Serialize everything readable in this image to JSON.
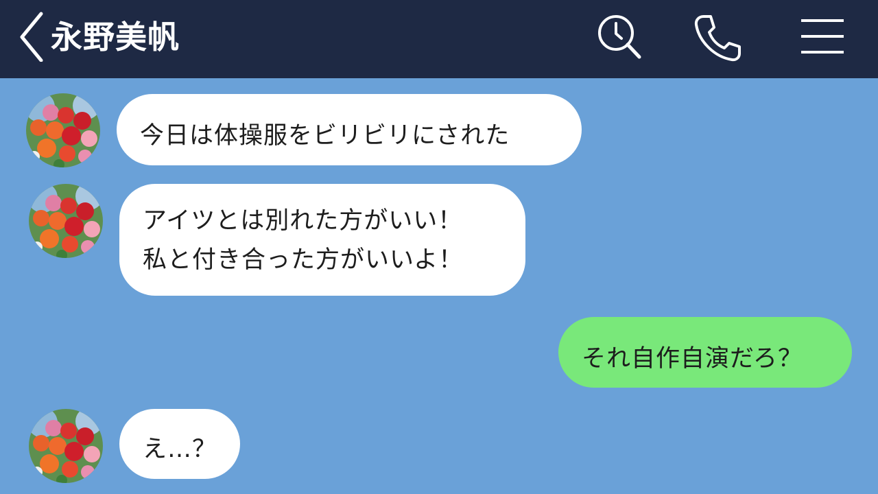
{
  "header": {
    "back_icon": "chevron-left-icon",
    "contact_name": "永野美帆",
    "icons": [
      "search-clock-icon",
      "phone-icon",
      "menu-icon"
    ]
  },
  "messages": [
    {
      "direction": "incoming",
      "avatar": "rose-bouquet-avatar",
      "lines": [
        "今日は体操服をビリビリにされた"
      ]
    },
    {
      "direction": "incoming",
      "avatar": "rose-bouquet-avatar",
      "lines": [
        "アイツとは別れた方がいい！",
        "私と付き合った方がいいよ！"
      ]
    },
    {
      "direction": "outgoing",
      "lines": [
        "それ自作自演だろ？"
      ]
    },
    {
      "direction": "incoming",
      "avatar": "rose-bouquet-avatar",
      "lines": [
        "え…？"
      ]
    }
  ],
  "colors": {
    "header_bg": "#1e2944",
    "chat_bg": "#6aa1d8",
    "incoming_bubble": "#ffffff",
    "outgoing_bubble": "#79e87a",
    "text": "#1d1d1d"
  }
}
